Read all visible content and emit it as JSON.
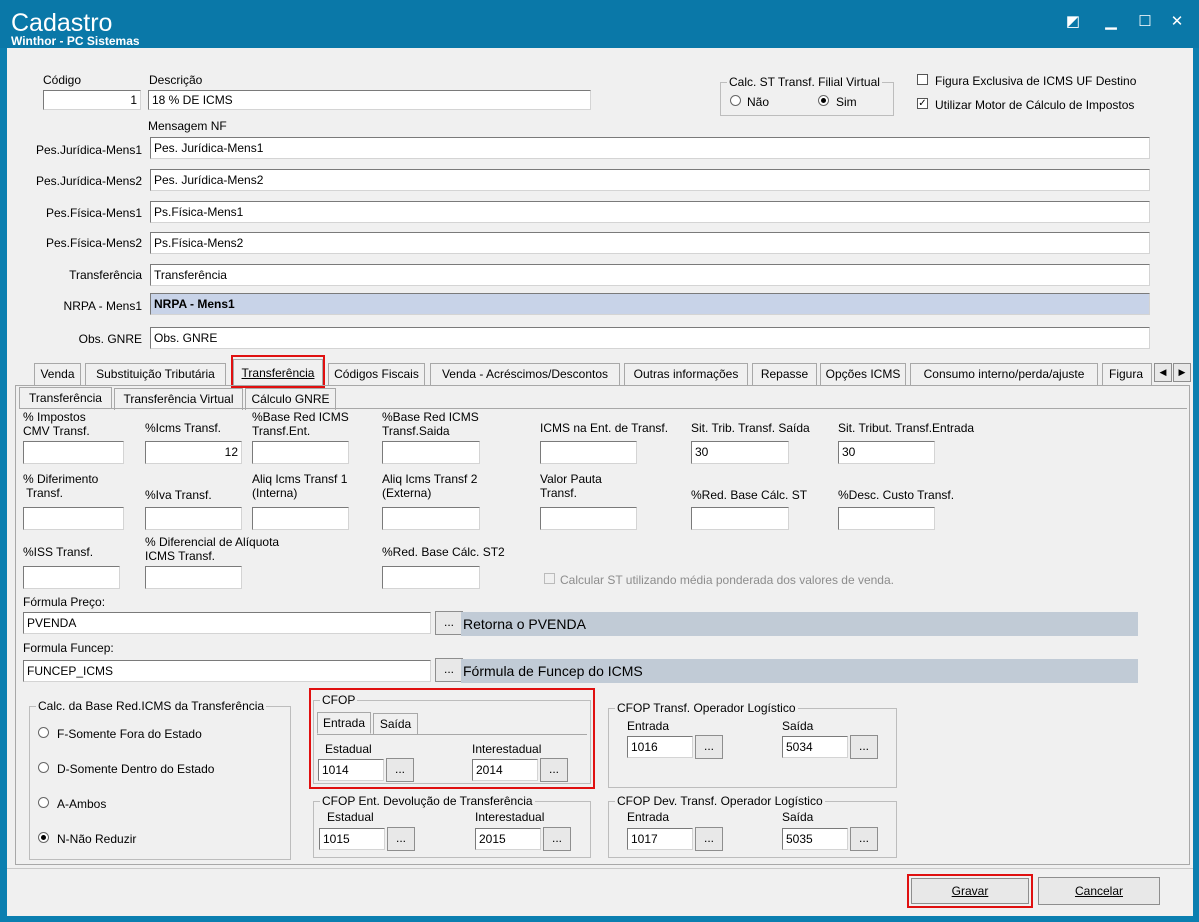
{
  "window": {
    "title": "Cadastro",
    "subtitle": "Winthor - PC Sistemas"
  },
  "header": {
    "codigo_label": "Código",
    "codigo_value": "1",
    "descricao_label": "Descrição",
    "descricao_value": "18 % DE ICMS",
    "calc_st_group": "Calc. ST Transf. Filial Virtual",
    "radio_nao": "Não",
    "radio_sim": "Sim",
    "figura_exclusiva": "Figura Exclusiva de ICMS UF Destino",
    "utilizar_motor": "Utilizar Motor de Cálculo de Impostos",
    "mensagem_nf": "Mensagem NF"
  },
  "messages": [
    {
      "label": "Pes.Jurídica-Mens1",
      "value": "Pes. Jurídica-Mens1"
    },
    {
      "label": "Pes.Jurídica-Mens2",
      "value": "Pes. Jurídica-Mens2"
    },
    {
      "label": "Pes.Física-Mens1",
      "value": "Ps.Física-Mens1"
    },
    {
      "label": "Pes.Física-Mens2",
      "value": "Ps.Física-Mens2"
    },
    {
      "label": "Transferência",
      "value": "Transferência"
    },
    {
      "label": "NRPA - Mens1",
      "value": "NRPA - Mens1"
    },
    {
      "label": "Obs. GNRE",
      "value": "Obs. GNRE"
    }
  ],
  "tabs": [
    "Venda",
    "Substituição Tributária",
    "Transferência",
    "Códigos Fiscais",
    "Venda - Acréscimos/Descontos",
    "Outras informações",
    "Repasse",
    "Opções ICMS",
    "Consumo interno/perda/ajuste",
    "Figura"
  ],
  "subtabs": [
    "Transferência",
    "Transferência Virtual",
    "Cálculo GNRE"
  ],
  "fields": {
    "impostos_cmv": "% Impostos\nCMV Transf.",
    "icms_transf": "%Icms Transf.",
    "icms_transf_value": "12",
    "base_red_ent": "%Base Red ICMS\nTransf.Ent.",
    "base_red_saida": "%Base Red ICMS\nTransf.Saida",
    "icms_ent_transf": "ICMS na Ent. de Transf.",
    "sit_trib_saida": "Sit. Trib. Transf. Saída",
    "sit_trib_saida_value": "30",
    "sit_trib_entrada": "Sit. Tribut. Transf.Entrada",
    "sit_trib_entrada_value": "30",
    "diferimento": "% Diferimento\n Transf.",
    "iva_transf": "%Iva Transf.",
    "aliq_1": "Aliq Icms Transf 1\n(Interna)",
    "aliq_2": "Aliq Icms Transf 2\n(Externa)",
    "valor_pauta": "Valor Pauta\nTransf.",
    "red_base_st": "%Red. Base Cálc. ST",
    "desc_custo": "%Desc. Custo Transf.",
    "iss_transf": "%ISS  Transf.",
    "diferencial_aliq": "% Diferencial de Alíquota\nICMS Transf.",
    "red_base_st2": "%Red. Base Cálc. ST2",
    "calcular_st": "Calcular ST utilizando média ponderada dos valores de venda.",
    "formula_preco": "Fórmula Preço:",
    "formula_preco_value": "PVENDA",
    "formula_preco_desc": "Retorna o PVENDA",
    "formula_funcep": "Formula Funcep:",
    "formula_funcep_value": "FUNCEP_ICMS",
    "formula_funcep_desc": "Fórmula de Funcep do ICMS",
    "dots": "..."
  },
  "base_red_group": {
    "title": "Calc. da Base Red.ICMS da Transferência",
    "options": [
      "F-Somente Fora do Estado",
      "D-Somente Dentro do Estado",
      "A-Ambos",
      "N-Não Reduzir"
    ],
    "selected": "N-Não Reduzir"
  },
  "cfop": {
    "title": "CFOP",
    "tab_entrada": "Entrada",
    "tab_saida": "Saída",
    "estadual_label": "Estadual",
    "estadual_value": "1014",
    "interestadual_label": "Interestadual",
    "interestadual_value": "2014"
  },
  "cfop_devolucao": {
    "title": "CFOP Ent. Devolução de Transferência",
    "estadual_label": "Estadual",
    "estadual_value": "1015",
    "interestadual_label": "Interestadual",
    "interestadual_value": "2015"
  },
  "cfop_operador": {
    "title": "CFOP Transf. Operador Logístico",
    "entrada_label": "Entrada",
    "entrada_value": "1016",
    "saida_label": "Saída",
    "saida_value": "5034"
  },
  "cfop_dev_operador": {
    "title": "CFOP Dev. Transf. Operador Logístico",
    "entrada_label": "Entrada",
    "entrada_value": "1017",
    "saida_label": "Saída",
    "saida_value": "5035"
  },
  "footer": {
    "gravar": "Gravar",
    "cancelar": "Cancelar"
  }
}
